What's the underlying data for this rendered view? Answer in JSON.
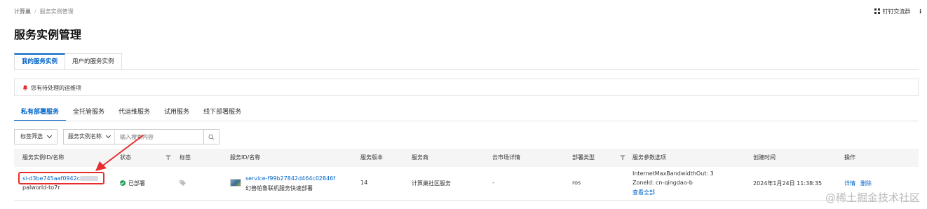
{
  "breadcrumb": {
    "root": "计算巢",
    "separator": "/",
    "current": "服务实例管理"
  },
  "top_right": {
    "dingtalk_label": "钉钉交流群",
    "more": "🔖"
  },
  "page_title": "服务实例管理",
  "primary_tabs": [
    {
      "label": "我的服务实例",
      "active": true
    },
    {
      "label": "用户的服务实例",
      "active": false
    }
  ],
  "notice": {
    "text": "您有待处理的运维项"
  },
  "secondary_tabs": [
    {
      "label": "私有部署服务",
      "active": true
    },
    {
      "label": "全托管服务",
      "active": false
    },
    {
      "label": "代运维服务",
      "active": false
    },
    {
      "label": "试用服务",
      "active": false
    },
    {
      "label": "线下部署服务",
      "active": false
    }
  ],
  "filters": {
    "tag_filter_label": "标签筛选",
    "field_select_label": "服务实例名称",
    "search_placeholder": "输入搜索内容"
  },
  "table": {
    "columns": [
      "服务实例ID/名称",
      "状态",
      "标签",
      "服务ID/名称",
      "服务版本",
      "服务商",
      "云市场详情",
      "部署类型",
      "服务参数选项",
      "创建时间",
      "操作"
    ],
    "rows": [
      {
        "instance_id": "si-d3be745aaf0942c",
        "instance_name": "palworld-to7r",
        "status": "已部署",
        "service_id": "service-f99b27842d464c02846f",
        "service_name": "幻兽帕鲁联机服务快速部署",
        "version": "14",
        "provider": "计算巢社区服务",
        "market": "-",
        "deploy_type": "ros",
        "params_line1": "InternetMaxBandwidthOut: 3",
        "params_line2": "ZoneId: cn-qingdao-b",
        "params_view_all": "查看全部",
        "created": "2024年1月24日 11:38:35",
        "action_detail": "详情",
        "action_delete": "删除"
      }
    ]
  },
  "watermark": "@稀土掘金技术社区",
  "colors": {
    "accent": "#0064c8",
    "success": "#23a055",
    "annotation": "#e62e2e"
  }
}
